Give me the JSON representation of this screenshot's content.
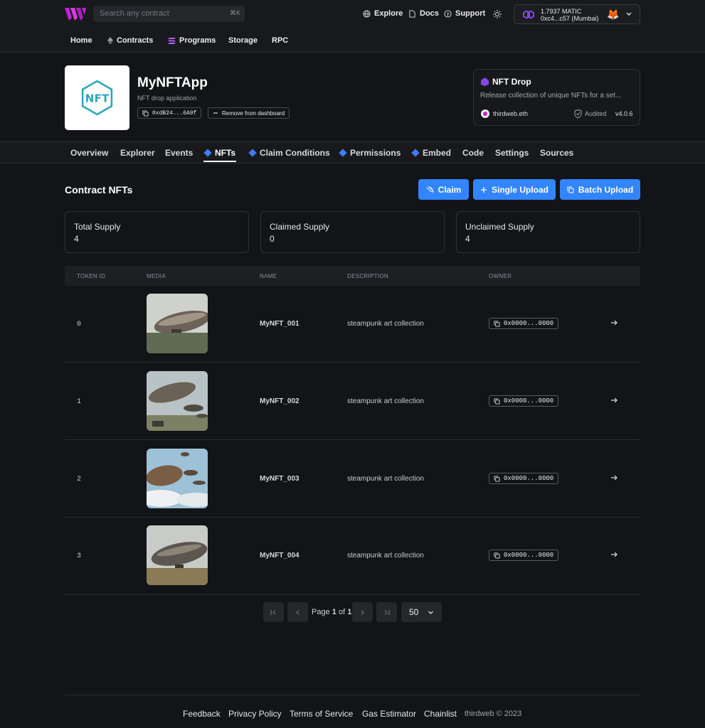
{
  "topbar": {
    "search_placeholder": "Search any contract",
    "search_shortcut": "⌘K",
    "links": [
      "Explore",
      "Docs",
      "Support"
    ],
    "wallet": {
      "balance": "1.7937 MATIC",
      "address": "0xc4...c57 (Mumbai)"
    }
  },
  "nav": [
    "Home",
    "Contracts",
    "Programs",
    "Storage",
    "RPC"
  ],
  "app": {
    "title": "MyNFTApp",
    "subtitle": "NFT drop application",
    "address": "0xdB24...6A9f",
    "remove_label": "Remove from dashboard",
    "thumb_text": "NFT"
  },
  "contract_card": {
    "title": "NFT Drop",
    "description": "Release collection of unique NFTs for a set...",
    "publisher": "thirdweb.eth",
    "audited": "Audited",
    "version": "v4.0.6"
  },
  "tabs": [
    "Overview",
    "Explorer",
    "Events",
    "NFTs",
    "Claim Conditions",
    "Permissions",
    "Embed",
    "Code",
    "Settings",
    "Sources"
  ],
  "section": {
    "title": "Contract NFTs",
    "buttons": [
      "Claim",
      "Single Upload",
      "Batch Upload"
    ]
  },
  "stats": [
    {
      "label": "Total Supply",
      "value": "4"
    },
    {
      "label": "Claimed Supply",
      "value": "0"
    },
    {
      "label": "Unclaimed Supply",
      "value": "4"
    }
  ],
  "table": {
    "headers": [
      "TOKEN ID",
      "MEDIA",
      "NAME",
      "DESCRIPTION",
      "OWNER"
    ],
    "rows": [
      {
        "id": "0",
        "name": "MyNFT_001",
        "description": "steampunk art collection",
        "owner": "0x0000...0000"
      },
      {
        "id": "1",
        "name": "MyNFT_002",
        "description": "steampunk art collection",
        "owner": "0x0000...0000"
      },
      {
        "id": "2",
        "name": "MyNFT_003",
        "description": "steampunk art collection",
        "owner": "0x0000...0000"
      },
      {
        "id": "3",
        "name": "MyNFT_004",
        "description": "steampunk art collection",
        "owner": "0x0000...0000"
      }
    ]
  },
  "pagination": {
    "page_prefix": "Page",
    "page": "1",
    "of": "of",
    "total": "1",
    "per_page": "50"
  },
  "footer": [
    "Feedback",
    "Privacy Policy",
    "Terms of Service",
    "Gas Estimator",
    "Chainlist",
    "thirdweb © 2023"
  ],
  "colors": {
    "accent": "#3385ff",
    "background": "#131417",
    "logo": "#c41fd6"
  }
}
